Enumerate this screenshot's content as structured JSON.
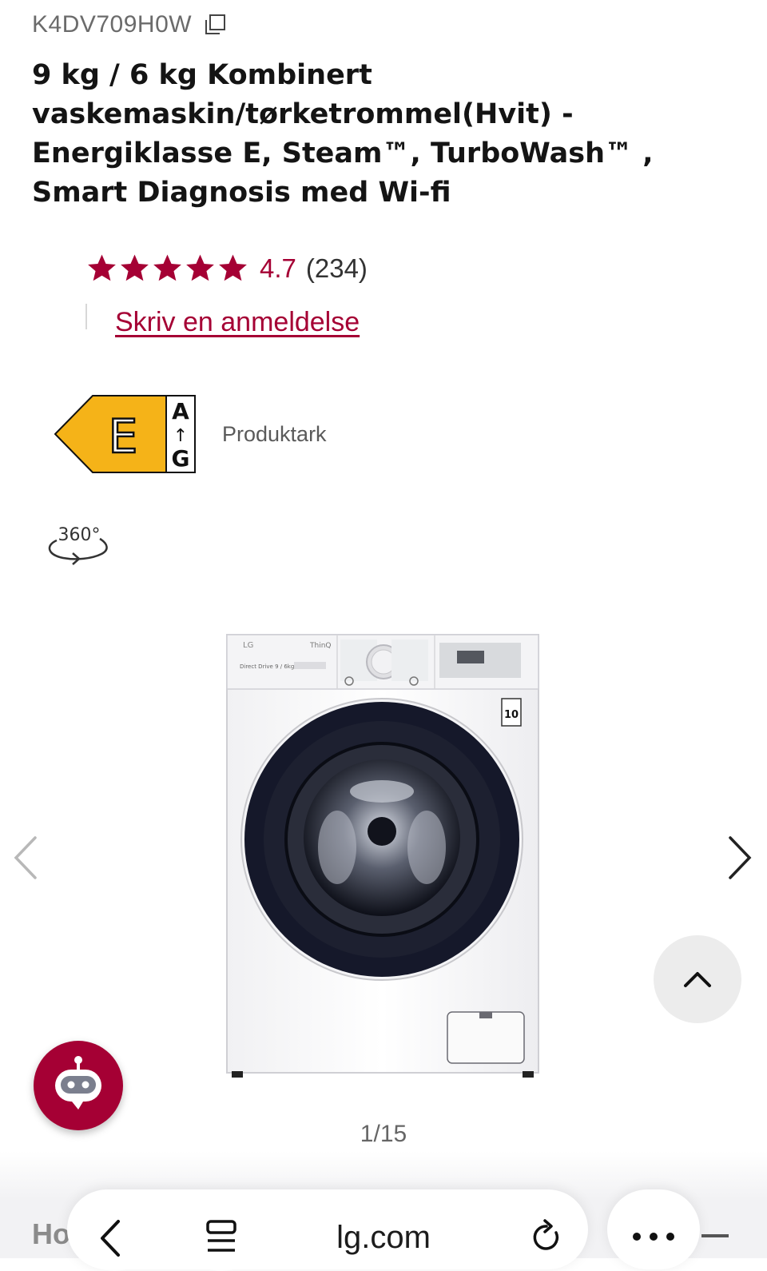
{
  "product": {
    "model": "K4DV709H0W",
    "title": "9 kg / 6 kg Kombinert vaskemaskin/tørketrommel(Hvit) - Energiklasse E, Steam™, TurboWash™ , Smart Diagnosis med Wi-fi"
  },
  "rating": {
    "stars": 5,
    "value": "4.7",
    "count": "(234)",
    "write_review": "Skriv en anmeldelse"
  },
  "energy": {
    "class": "E",
    "scale_top": "A",
    "scale_arrow": "↑",
    "scale_bottom": "G",
    "datasheet": "Produktark",
    "color": "#f5b318"
  },
  "view360": {
    "label": "360°"
  },
  "gallery": {
    "counter": "1/15"
  },
  "appliance_labels": {
    "brand": "LG",
    "thinq": "ThinQ",
    "drive": "Direct Drive 9 / 6kg",
    "warranty": "10"
  },
  "browser": {
    "url": "lg.com",
    "partial_text": "Ho"
  },
  "colors": {
    "accent": "#a50034",
    "scroll_top_bg": "#ececec"
  }
}
